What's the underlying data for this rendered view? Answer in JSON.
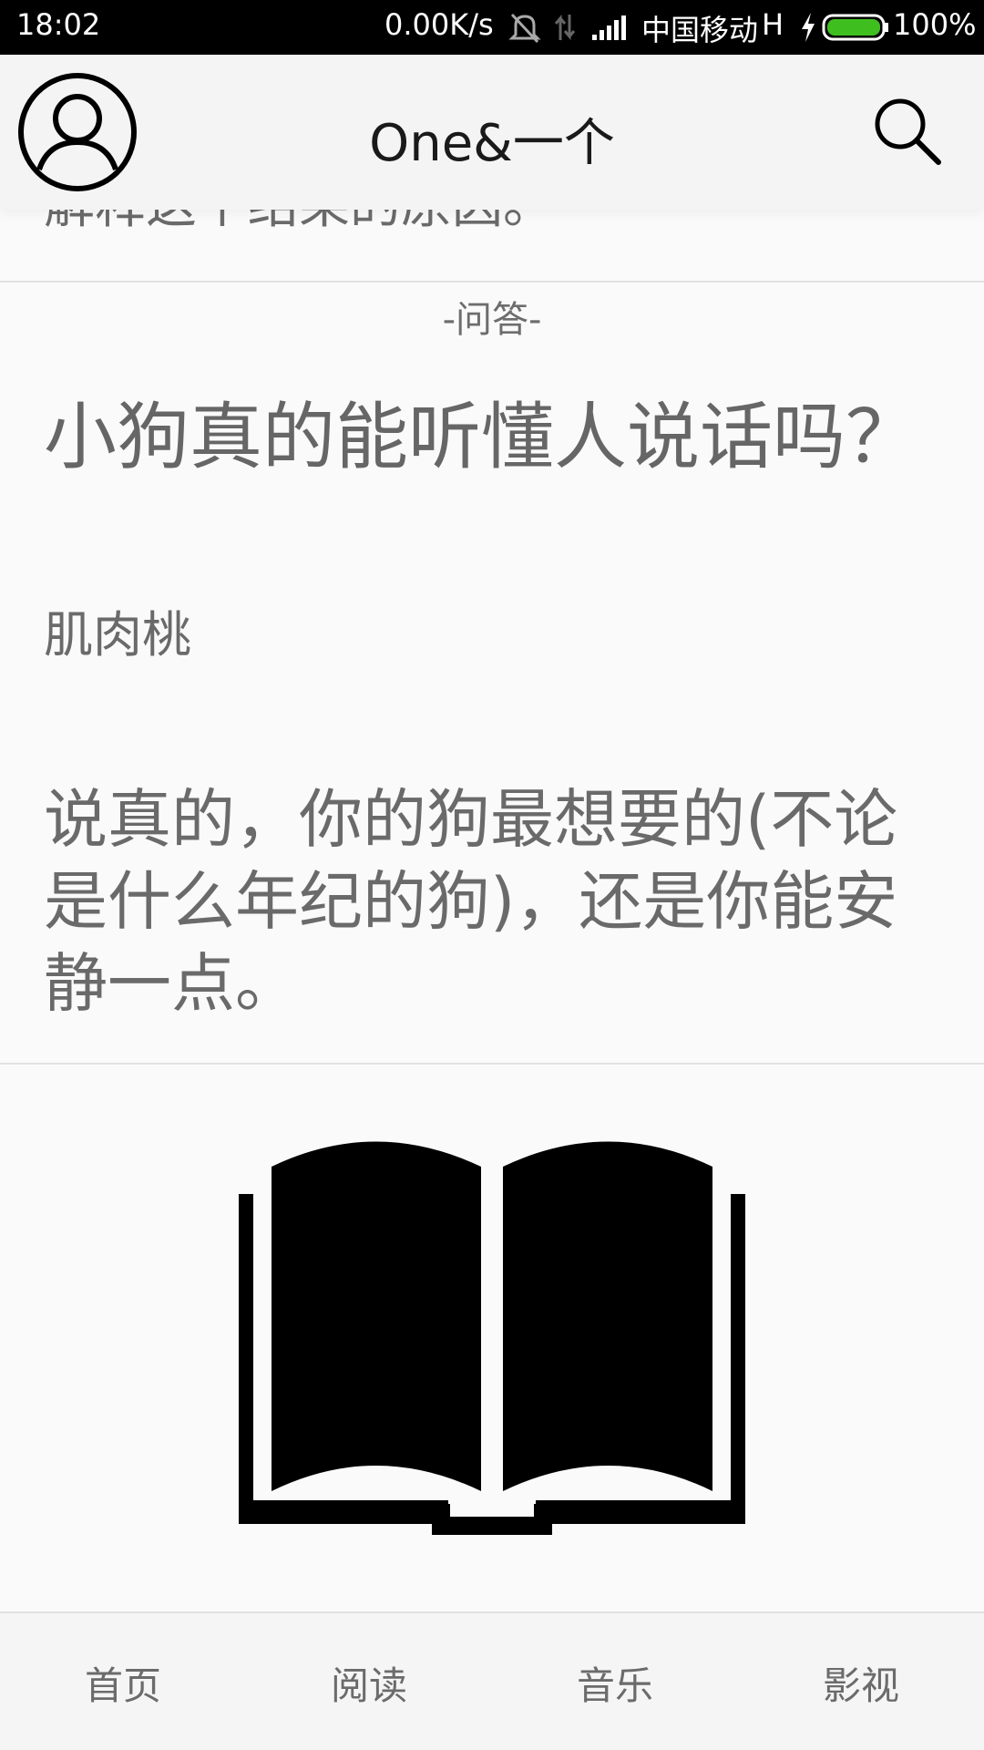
{
  "status_bar": {
    "time": "18:02",
    "net_speed": "0.00K/s",
    "carrier": "中国移动",
    "network_type": "H",
    "battery_percent": "100%",
    "icons": [
      "mute-icon",
      "data-transfer-icon",
      "signal-icon",
      "charging-icon",
      "battery-icon"
    ],
    "battery_color": "#3fbf1f"
  },
  "header": {
    "title": "One&一个",
    "left_icon": "user-avatar-icon",
    "right_icon": "search-icon"
  },
  "content": {
    "previous_item_tail": "解释这个结果的原因。",
    "qa_section": {
      "label": "-问答-",
      "title": "小狗真的能听懂人说话吗？",
      "author": "肌肉桃",
      "excerpt": "说真的，你的狗最想要的(不论是什么年纪的狗)，还是你能安静一点。"
    },
    "next_section_icon": "open-book-icon"
  },
  "bottom_nav": {
    "items": [
      {
        "label": "首页"
      },
      {
        "label": "阅读"
      },
      {
        "label": "音乐"
      },
      {
        "label": "影视"
      }
    ]
  }
}
